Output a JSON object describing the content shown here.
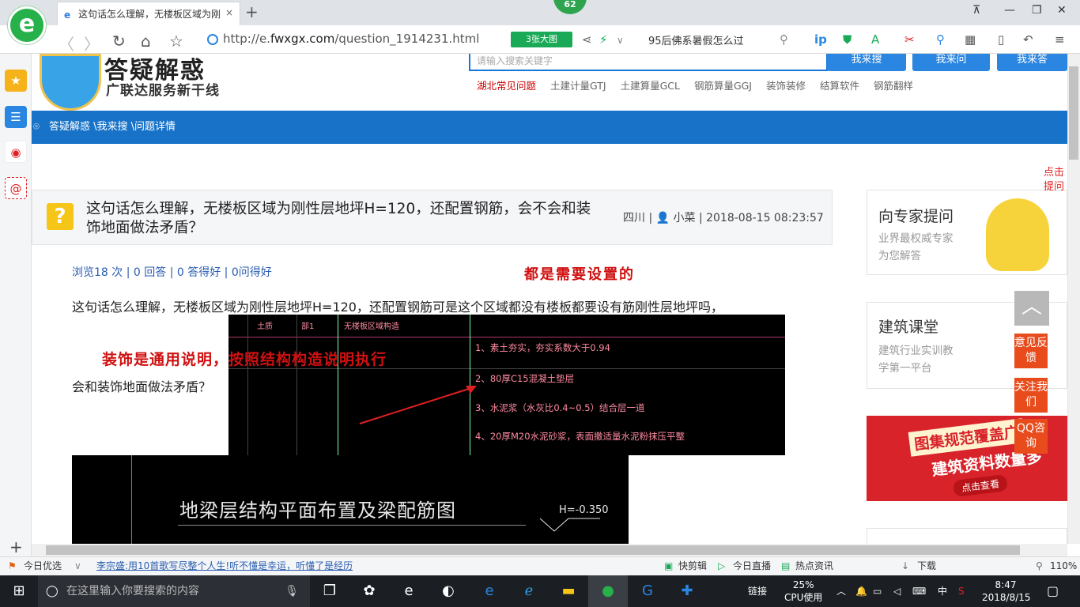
{
  "browser": {
    "logo_letter": "e",
    "tab_title": "这句话怎么理解，无楼板区域为刚",
    "tab_close": "×",
    "new_tab": "+",
    "badge": "62",
    "window_buttons": [
      "⊼",
      "—",
      "❐",
      "✕"
    ],
    "nav_back": "〈",
    "nav_forward": "〉",
    "nav_reload": "↻",
    "nav_home": "⌂",
    "nav_fav": "☆",
    "url_prefix": "http://e.",
    "url_main": "fwxgx.com",
    "url_rest": "/question_1914231.html",
    "image_mode": "3张大图",
    "search_query": "95后佛系暑假怎么过",
    "search_icon": "⚲"
  },
  "sidebar": {
    "icons": [
      "star-icon",
      "list-icon",
      "weibo-icon",
      "mail-icon"
    ],
    "plus": "+"
  },
  "site": {
    "title": "答疑解惑",
    "slogan": "广联达服务新干线",
    "search_placeholder": "请输入搜索关键字",
    "buttons": [
      "我来搜",
      "我来问",
      "我来答"
    ],
    "hotlinks": [
      "湖北常见问题",
      "土建计量GTJ",
      "土建算量GCL",
      "钢筋算量GGJ",
      "装饰装修",
      "结算软件",
      "钢筋翻样"
    ],
    "breadcrumb": "答疑解惑 \\我来搜 \\问题详情"
  },
  "question": {
    "icon": "?",
    "title": "这句话怎么理解，无楼板区域为刚性层地坪H=120，还配置钢筋，会不会和装饰地面做法矛盾？",
    "meta": "四川 | 👤 小菜 | 2018-08-15 08:23:57",
    "stats": "浏览18 次 | 0 回答 | 0 答得好 | 0问得好",
    "red_answer": "都是需要设置的",
    "body_line1": "这句话怎么理解，无楼板区域为刚性层地坪H=120，还配置钢筋可是这个区域都没有楼板都要设有筋刚性层地坪吗，",
    "body_line2": "会和装饰地面做法矛盾？",
    "red_note": "装饰是通用说明，按照结构构造说明执行",
    "cad1_lines": [
      "1、素土夯实，夯实系数大于0.94",
      "2、80厚C15混凝土垫层",
      "3、水泥浆（水灰比0.4~0.5）结合层一道",
      "4、20厚M20水泥砂浆，表面撒适量水泥粉抹压平整"
    ],
    "cad1_headers": [
      "土质",
      "部1",
      "无楼板区域构造"
    ],
    "cad2_title": "地梁层结构平面布置及梁配筋图",
    "cad2_level": "H=-0.350"
  },
  "right": {
    "card1_title": "向专家提问",
    "card1_sub1": "业界最权威专家",
    "card1_sub2": "为您解答",
    "card2_title": "建筑课堂",
    "card2_sub1": "建筑行业实训教",
    "card2_sub2": "学第一平台",
    "ad_line1": "图集规范覆盖广",
    "ad_line2": "建筑资料数量多",
    "ad_btn": "点击查看",
    "float_top": "︿",
    "float_feedback": "意见反馈",
    "float_follow": "关注我们",
    "float_qq": "QQ咨询",
    "float_corner": "点击提问"
  },
  "statusbar": {
    "left": "今日优选",
    "news": "李宗盛:用10首歌写尽整个人生!听不懂是幸运，听懂了是经历",
    "items": [
      "快剪辑",
      "今日直播",
      "热点资讯",
      "下载"
    ],
    "zoom": "110%"
  },
  "taskbar": {
    "search_placeholder": "在这里输入你要搜索的内容",
    "link": "链接",
    "cpu_pct": "25%",
    "cpu_label": "CPU使用",
    "ime": "中",
    "time": "8:47",
    "date": "2018/8/15"
  }
}
